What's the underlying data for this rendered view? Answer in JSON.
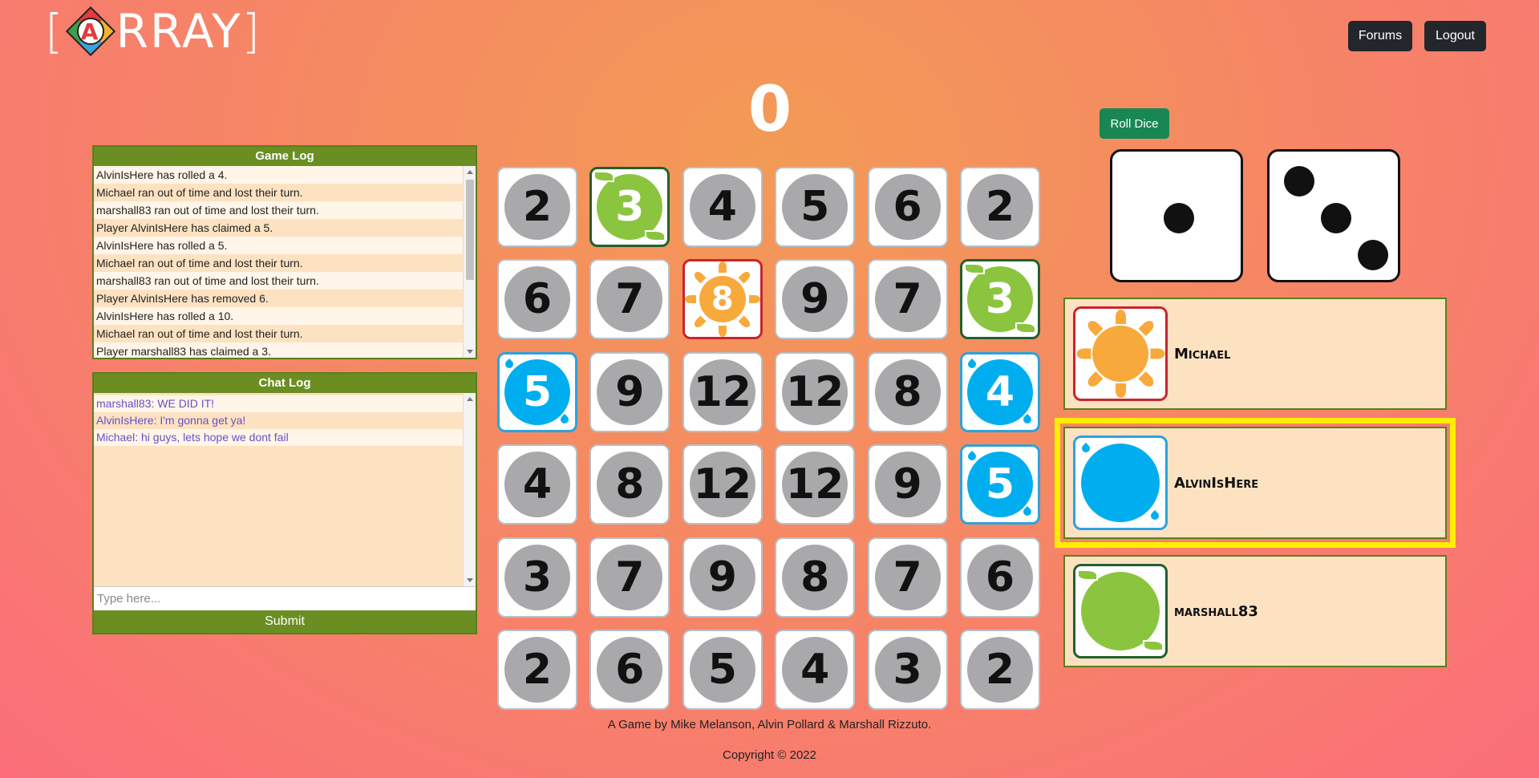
{
  "header": {
    "logo_open": "[",
    "logo_letter": "A",
    "logo_rest": "RRAY",
    "logo_close": "]",
    "forums_label": "Forums",
    "logout_label": "Logout"
  },
  "score": "0",
  "game_log": {
    "title": "Game Log",
    "entries": [
      "AlvinIsHere has rolled a 4.",
      "Michael ran out of time and lost their turn.",
      "marshall83 ran out of time and lost their turn.",
      "Player AlvinIsHere has claimed a 5.",
      "AlvinIsHere has rolled a 5.",
      "Michael ran out of time and lost their turn.",
      "marshall83 ran out of time and lost their turn.",
      "Player AlvinIsHere has removed 6.",
      "AlvinIsHere has rolled a 10.",
      "Michael ran out of time and lost their turn.",
      "Player marshall83 has claimed a 3."
    ]
  },
  "chat_log": {
    "title": "Chat Log",
    "messages": [
      "marshall83: WE DID IT!",
      "AlvinIsHere: I'm gonna get ya!",
      "Michael: hi guys, lets hope we dont fail"
    ],
    "input_placeholder": "Type here...",
    "submit_label": "Submit"
  },
  "board": [
    [
      {
        "n": "2",
        "t": "plain"
      },
      {
        "n": "3",
        "t": "leaf"
      },
      {
        "n": "4",
        "t": "plain"
      },
      {
        "n": "5",
        "t": "plain"
      },
      {
        "n": "6",
        "t": "plain"
      },
      {
        "n": "2",
        "t": "plain"
      }
    ],
    [
      {
        "n": "6",
        "t": "plain"
      },
      {
        "n": "7",
        "t": "plain"
      },
      {
        "n": "8",
        "t": "sun"
      },
      {
        "n": "9",
        "t": "plain"
      },
      {
        "n": "7",
        "t": "plain"
      },
      {
        "n": "3",
        "t": "leaf"
      }
    ],
    [
      {
        "n": "5",
        "t": "water"
      },
      {
        "n": "9",
        "t": "plain"
      },
      {
        "n": "12",
        "t": "plain"
      },
      {
        "n": "12",
        "t": "plain"
      },
      {
        "n": "8",
        "t": "plain"
      },
      {
        "n": "4",
        "t": "water"
      }
    ],
    [
      {
        "n": "4",
        "t": "plain"
      },
      {
        "n": "8",
        "t": "plain"
      },
      {
        "n": "12",
        "t": "plain"
      },
      {
        "n": "12",
        "t": "plain"
      },
      {
        "n": "9",
        "t": "plain"
      },
      {
        "n": "5",
        "t": "water"
      }
    ],
    [
      {
        "n": "3",
        "t": "plain"
      },
      {
        "n": "7",
        "t": "plain"
      },
      {
        "n": "9",
        "t": "plain"
      },
      {
        "n": "8",
        "t": "plain"
      },
      {
        "n": "7",
        "t": "plain"
      },
      {
        "n": "6",
        "t": "plain"
      }
    ],
    [
      {
        "n": "2",
        "t": "plain"
      },
      {
        "n": "6",
        "t": "plain"
      },
      {
        "n": "5",
        "t": "plain"
      },
      {
        "n": "4",
        "t": "plain"
      },
      {
        "n": "3",
        "t": "plain"
      },
      {
        "n": "2",
        "t": "plain"
      }
    ]
  ],
  "dice": {
    "roll_label": "Roll Dice",
    "values": [
      1,
      3
    ]
  },
  "players": [
    {
      "name": "Michael",
      "icon": "sun-icon",
      "active": false
    },
    {
      "name": "AlvinIsHere",
      "icon": "water-drop-icon",
      "active": true
    },
    {
      "name": "marshall83",
      "icon": "leaf-icon",
      "active": false
    }
  ],
  "footer": {
    "credits": "A Game by Mike Melanson, Alvin Pollard & Marshall Rizzuto.",
    "copyright": "Copyright © 2022"
  }
}
